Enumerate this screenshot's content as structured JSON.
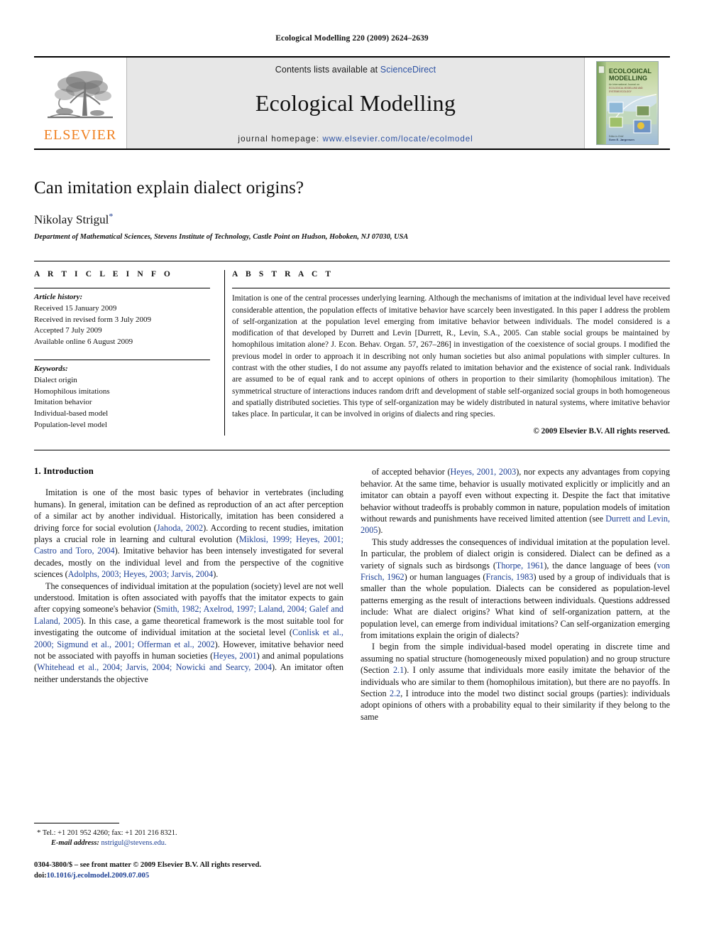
{
  "running_head": "Ecological Modelling 220 (2009) 2624–2639",
  "masthead": {
    "publisher_logo_text": "ELSEVIER",
    "contents_prefix": "Contents lists available at",
    "sciencedirect": "ScienceDirect",
    "journal_title": "Ecological Modelling",
    "homepage_label": "journal homepage:",
    "homepage_url": "www.elsevier.com/locate/ecolmodel",
    "cover_title_line1": "ECOLOGICAL",
    "cover_title_line2": "MODELLING",
    "accent_orange": "#f08020",
    "link_blue": "#2c51a3",
    "panel_gray": "#e7e7e7"
  },
  "article": {
    "title": "Can imitation explain dialect origins?",
    "author": "Nikolay Strigul",
    "author_marker": "*",
    "affiliation": "Department of Mathematical Sciences, Stevens Institute of Technology, Castle Point on Hudson, Hoboken, NJ 07030, USA"
  },
  "info": {
    "heading": "A R T I C L E    I N F O",
    "history_label": "Article history:",
    "history": [
      "Received 15 January 2009",
      "Received in revised form 3 July 2009",
      "Accepted 7 July 2009",
      "Available online 6 August 2009"
    ],
    "keywords_label": "Keywords:",
    "keywords": [
      "Dialect origin",
      "Homophilous imitations",
      "Imitation behavior",
      "Individual-based model",
      "Population-level model"
    ]
  },
  "abstract": {
    "heading": "A B S T R A C T",
    "text": "Imitation is one of the central processes underlying learning. Although the mechanisms of imitation at the individual level have received considerable attention, the population effects of imitative behavior have scarcely been investigated. In this paper I address the problem of self-organization at the population level emerging from imitative behavior between individuals. The model considered is a modification of that developed by Durrett and Levin [Durrett, R., Levin, S.A., 2005. Can stable social groups be maintained by homophilous imitation alone? J. Econ. Behav. Organ. 57, 267–286] in investigation of the coexistence of social groups. I modified the previous model in order to approach it in describing not only human societies but also animal populations with simpler cultures. In contrast with the other studies, I do not assume any payoffs related to imitation behavior and the existence of social rank. Individuals are assumed to be of equal rank and to accept opinions of others in proportion to their similarity (homophilous imitation). The symmetrical structure of interactions induces random drift and development of stable self-organized social groups in both homogeneous and spatially distributed societies. This type of self-organization may be widely distributed in natural systems, where imitative behavior takes place. In particular, it can be involved in origins of dialects and ring species.",
    "copyright": "© 2009 Elsevier B.V. All rights reserved."
  },
  "body": {
    "section_heading": "1.  Introduction",
    "left_paragraphs": [
      "Imitation is one of the most basic types of behavior in vertebrates (including humans). In general, imitation can be defined as reproduction of an act after perception of a similar act by another individual. Historically, imitation has been considered a driving force for social evolution (Jahoda, 2002). According to recent studies, imitation plays a crucial role in learning and cultural evolution (Miklosi, 1999; Heyes, 2001; Castro and Toro, 2004). Imitative behavior has been intensely investigated for several decades, mostly on the individual level and from the perspective of the cognitive sciences (Adolphs, 2003; Heyes, 2003; Jarvis, 2004).",
      "The consequences of individual imitation at the population (society) level are not well understood. Imitation is often associated with payoffs that the imitator expects to gain after copying someone's behavior (Smith, 1982; Axelrod, 1997; Laland, 2004; Galef and Laland, 2005). In this case, a game theoretical framework is the most suitable tool for investigating the outcome of individual imitation at the societal level (Conlisk et al., 2000; Sigmund et al., 2001; Offerman et al., 2002). However, imitative behavior need not be associated with payoffs in human societies (Heyes, 2001) and animal populations (Whitehead et al., 2004; Jarvis, 2004; Nowicki and Searcy, 2004). An imitator often neither understands the objective"
    ],
    "right_paragraphs": [
      "of accepted behavior (Heyes, 2001, 2003), nor expects any advantages from copying behavior. At the same time, behavior is usually motivated explicitly or implicitly and an imitator can obtain a payoff even without expecting it. Despite the fact that imitative behavior without tradeoffs is probably common in nature, population models of imitation without rewards and punishments have received limited attention (see Durrett and Levin, 2005).",
      "This study addresses the consequences of individual imitation at the population level. In particular, the problem of dialect origin is considered. Dialect can be defined as a variety of signals such as birdsongs (Thorpe, 1961), the dance language of bees (von Frisch, 1962) or human languages (Francis, 1983) used by a group of individuals that is smaller than the whole population. Dialects can be considered as population-level patterns emerging as the result of interactions between individuals. Questions addressed include: What are dialect origins? What kind of self-organization pattern, at the population level, can emerge from individual imitations? Can self-organization emerging from imitations explain the origin of dialects?",
      "I begin from the simple individual-based model operating in discrete time and assuming no spatial structure (homogeneously mixed population) and no group structure (Section 2.1). I only assume that individuals more easily imitate the behavior of the individuals who are similar to them (homophilous imitation), but there are no payoffs. In Section 2.2, I introduce into the model two distinct social groups (parties): individuals adopt opinions of others with a probability equal to their similarity if they belong to the same"
    ]
  },
  "footnotes": {
    "corresponding_marker": "*",
    "contact": "Tel.: +1 201 952 4260; fax: +1 201 216 8321.",
    "email_label": "E-mail address:",
    "email": "nstrigul@stevens.edu.",
    "issn_line": "0304-3800/$ – see front matter © 2009 Elsevier B.V. All rights reserved.",
    "doi_label": "doi:",
    "doi": "10.1016/j.ecolmodel.2009.07.005"
  }
}
